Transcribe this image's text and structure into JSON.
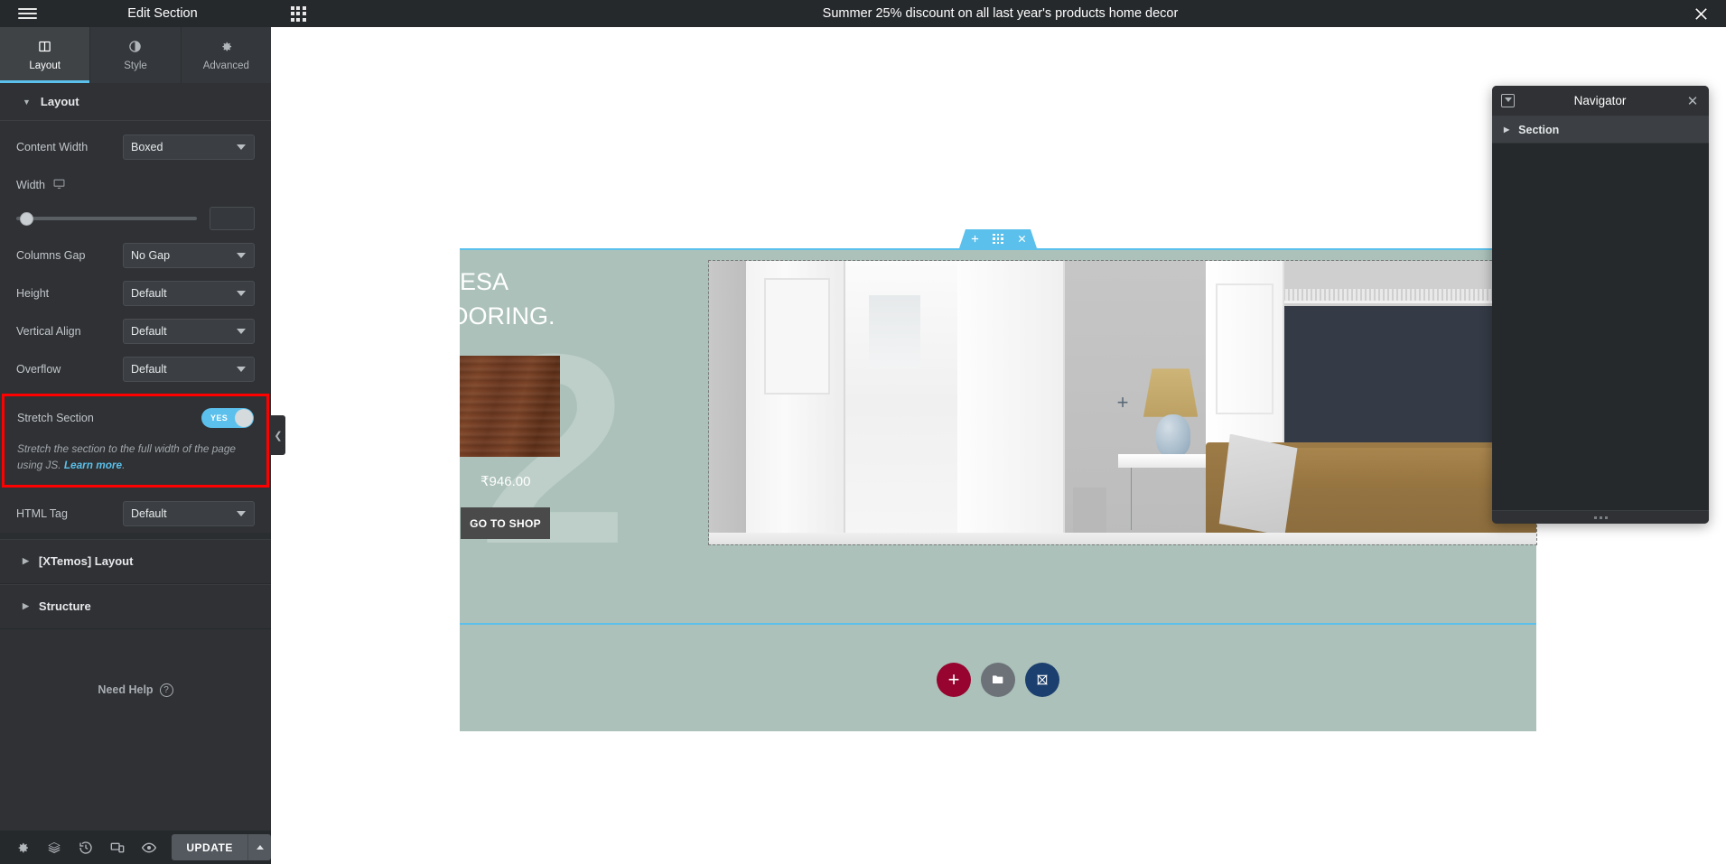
{
  "topbar": {
    "hamburger_icon": "hamburger-menu-icon",
    "title": "Edit Section",
    "apps_icon": "apps-grid-icon",
    "center_text": "Summer 25% discount on all last year's products home decor",
    "close_icon": "close-icon"
  },
  "panel": {
    "tabs": [
      {
        "label": "Layout",
        "icon": "layout-columns-icon",
        "active": true
      },
      {
        "label": "Style",
        "icon": "contrast-circle-icon",
        "active": false
      },
      {
        "label": "Advanced",
        "icon": "gear-icon",
        "active": false
      }
    ],
    "section_title": "Layout",
    "controls": [
      {
        "label": "Content Width",
        "value": "Boxed"
      },
      {
        "label": "Columns Gap",
        "value": "No Gap"
      },
      {
        "label": "Height",
        "value": "Default"
      },
      {
        "label": "Vertical Align",
        "value": "Default"
      },
      {
        "label": "Overflow",
        "value": "Default"
      }
    ],
    "width": {
      "label": "Width",
      "device_icon": "desktop-icon",
      "value": "",
      "slider_percent": 0
    },
    "stretch": {
      "label": "Stretch Section",
      "toggle_value": "YES",
      "toggle_on": true,
      "description_prefix": "Stretch the section to the full width of the page using JS. ",
      "link_text": "Learn more",
      "description_suffix": "."
    },
    "html_tag": {
      "label": "HTML Tag",
      "value": "Default"
    },
    "accordions": [
      {
        "label": "[XTemos] Layout"
      },
      {
        "label": "Structure"
      }
    ],
    "need_help": "Need Help",
    "footer": {
      "icons": [
        "gear-icon",
        "layers-icon",
        "history-icon",
        "responsive-mode-icon",
        "preview-eye-icon"
      ],
      "update_label": "UPDATE",
      "update_caret_icon": "chevron-up-icon"
    },
    "collapse_icon": "chevron-left-icon"
  },
  "canvas": {
    "section_toolbar": {
      "add_icon": "plus-icon",
      "drag_icon": "drag-handle-icon",
      "remove_icon": "close-icon"
    },
    "hero": {
      "headline_line1": "TION TESA",
      "headline_line2": "EN FLOORING.",
      "background_numeral": "2",
      "price": "₹946.00",
      "cta_label": "GO TO SHOP",
      "product_thumb_alt": "wood-flooring-swatch"
    },
    "widget_add_icon": "plus-icon",
    "add_buttons": [
      {
        "name": "add-new-section-button",
        "icon": "plus-icon",
        "color": "#96042f"
      },
      {
        "name": "add-template-button",
        "icon": "folder-icon",
        "color": "#6d7278"
      },
      {
        "name": "xtemos-templates-button",
        "icon": "xtemos-icon",
        "color": "#1b3f6e"
      }
    ],
    "section_bg_color": "#abc1b9",
    "accent_color": "#5bc0eb"
  },
  "navigator": {
    "dock_icon": "dock-panel-icon",
    "title": "Navigator",
    "close_icon": "close-icon",
    "items": [
      {
        "label": "Section",
        "caret_icon": "chevron-right-icon"
      }
    ],
    "resize_grip_icon": "resize-grip-icon"
  }
}
